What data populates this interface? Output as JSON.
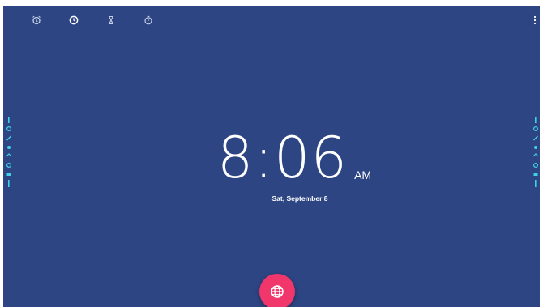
{
  "app": {
    "tabs": [
      {
        "id": "alarm",
        "icon": "alarm-icon"
      },
      {
        "id": "clock",
        "icon": "clock-icon"
      },
      {
        "id": "timer",
        "icon": "hourglass-icon"
      },
      {
        "id": "stopwatch",
        "icon": "stopwatch-icon"
      }
    ],
    "active_tab": "clock",
    "overflow_icon": "more-vert-icon"
  },
  "clock": {
    "time": "8:06",
    "ampm": "AM",
    "date": "Sat, September 8"
  },
  "fab": {
    "icon": "globe-icon",
    "color": "#f0366b"
  },
  "theme": {
    "background": "#2d4583",
    "accent": "#3fd0ea",
    "text": "#ffffff"
  }
}
